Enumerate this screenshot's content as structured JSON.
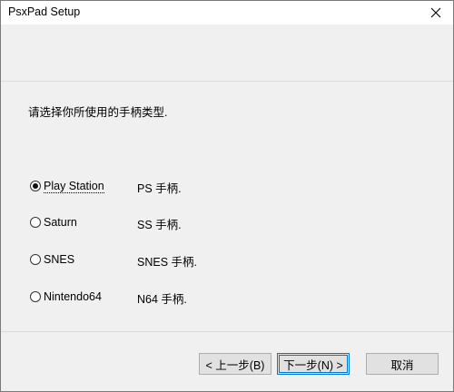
{
  "window": {
    "title": "PsxPad Setup"
  },
  "content": {
    "instruction": "请选择你所使用的手柄类型.",
    "options": [
      {
        "label": "Play Station",
        "description": "PS 手柄.",
        "selected": true
      },
      {
        "label": "Saturn",
        "description": "SS 手柄.",
        "selected": false
      },
      {
        "label": "SNES",
        "description": "SNES 手柄.",
        "selected": false
      },
      {
        "label": "Nintendo64",
        "description": "N64 手柄.",
        "selected": false
      }
    ]
  },
  "footer": {
    "back_label": "< 上一步(B)",
    "next_label": "下一步(N) >",
    "cancel_label": "取消"
  },
  "colors": {
    "focus_border": "#0078d7",
    "button_face": "#e1e1e1",
    "dialog_bg": "#f0f0f0"
  }
}
